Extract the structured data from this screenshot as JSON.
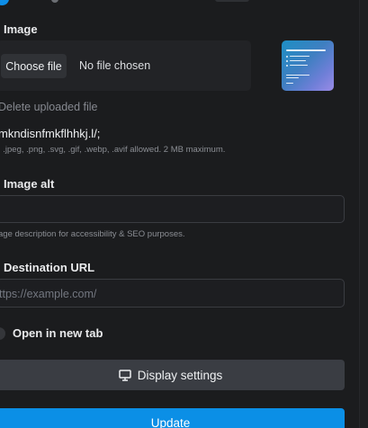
{
  "image_section": {
    "label": "Image",
    "choose_file_label": "Choose file",
    "no_file_text": "No file chosen",
    "delete_label": "Delete uploaded file",
    "current_filename": "mkndisnfmkflhhkj.l/;",
    "help_text": ", .jpeg, .png, .svg, .gif, .webp, .avif allowed. 2 MB maximum."
  },
  "image_alt": {
    "label": "Image alt",
    "value": "",
    "help_text": "age description for accessibility & SEO purposes."
  },
  "destination_url": {
    "label": "Destination URL",
    "placeholder": "ttps://example.com/"
  },
  "open_new_tab": {
    "label": "Open in new tab",
    "checked": false
  },
  "display_settings_label": "Display settings",
  "update_label": "Update",
  "colors": {
    "background": "#1b1c1e",
    "primary": "#0b8fe6",
    "secondary_button": "#3a3d43"
  },
  "icons": {
    "display": "monitor-icon"
  }
}
